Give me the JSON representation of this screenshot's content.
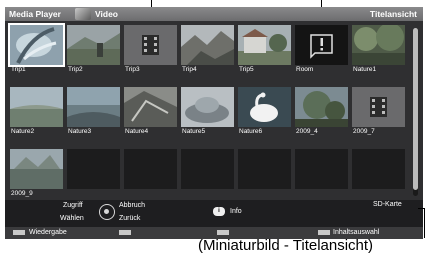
{
  "header": {
    "app_title": "Media Player",
    "section": "Video",
    "view": "Titelansicht"
  },
  "thumbnails": [
    {
      "label": "Trip1",
      "icon": "photo"
    },
    {
      "label": "Trip2",
      "icon": "photo"
    },
    {
      "label": "Trip3",
      "icon": "film-strip-icon"
    },
    {
      "label": "Trip4",
      "icon": "photo"
    },
    {
      "label": "Trip5",
      "icon": "photo"
    },
    {
      "label": "Room",
      "icon": "warning-icon"
    },
    {
      "label": "Nature1",
      "icon": "photo"
    },
    {
      "label": "Nature2",
      "icon": "photo"
    },
    {
      "label": "Nature3",
      "icon": "photo"
    },
    {
      "label": "Nature4",
      "icon": "photo"
    },
    {
      "label": "Nature5",
      "icon": "photo"
    },
    {
      "label": "Nature6",
      "icon": "photo"
    },
    {
      "label": "2009_4",
      "icon": "photo"
    },
    {
      "label": "2009_7",
      "icon": "film-strip-icon"
    },
    {
      "label": "2009_9",
      "icon": "photo"
    }
  ],
  "footer": {
    "zugriff": "Zugriff",
    "abbruch": "Abbruch",
    "waehlen": "Wählen",
    "zurueck": "Zurück",
    "info_key": "i",
    "info": "Info",
    "sd_karte": "SD-Karte"
  },
  "color_keys": {
    "red": "Wiedergabe",
    "green": "",
    "yellow": "",
    "blue": "Inhaltsauswahl"
  },
  "caption": "(Miniaturbild - Titelansicht)",
  "colors": {
    "selection": "#ffffff",
    "panel": "#2f2f31",
    "header": "#7a7a7c"
  }
}
